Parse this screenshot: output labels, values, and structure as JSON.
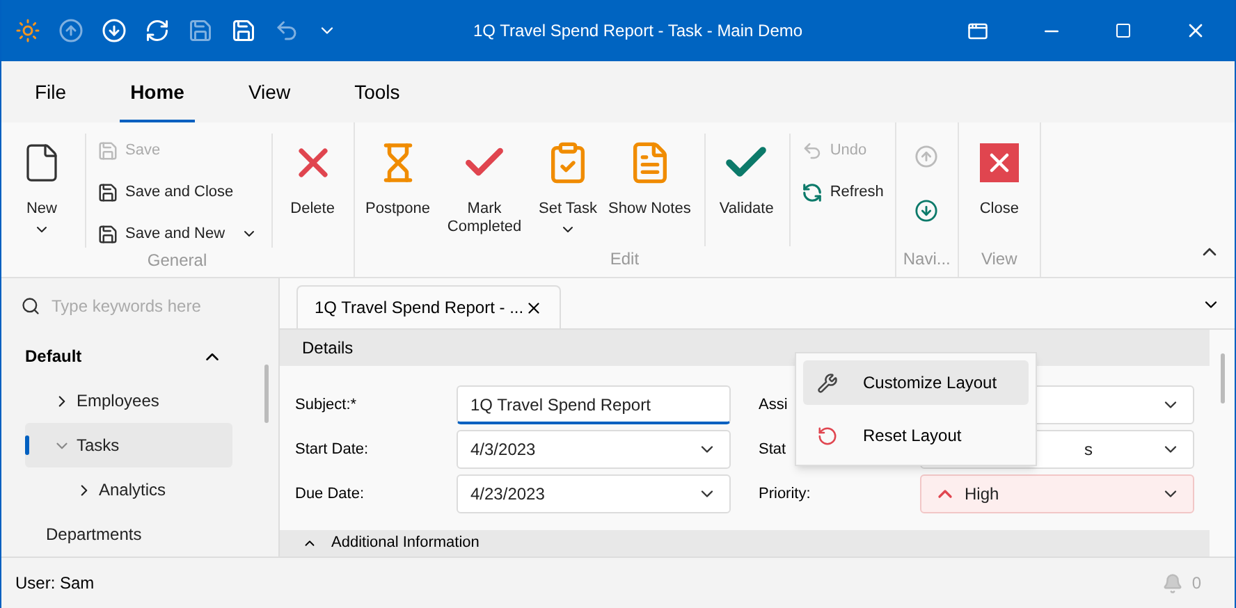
{
  "window": {
    "title": "1Q Travel Spend Report - Task - Main Demo"
  },
  "quick_access": [
    {
      "disabled": false
    },
    {
      "disabled": true
    },
    {
      "disabled": false
    },
    {
      "disabled": false
    },
    {
      "disabled": true
    },
    {
      "disabled": false
    },
    {
      "disabled": true
    },
    {
      "disabled": false
    }
  ],
  "menu_tabs": [
    {
      "label": "File",
      "selected": false
    },
    {
      "label": "Home",
      "selected": true
    },
    {
      "label": "View",
      "selected": false
    },
    {
      "label": "Tools",
      "selected": false
    }
  ],
  "ribbon": {
    "groups": [
      {
        "label": "General",
        "sections": [
          [
            {
              "kind": "large",
              "label": "New",
              "dropdown": true,
              "disabled": false
            }
          ],
          [
            {
              "kind": "stack",
              "items": [
                {
                  "label": "Save",
                  "disabled": true,
                  "dropdown": false
                },
                {
                  "label": "Save and Close",
                  "disabled": false,
                  "dropdown": false
                },
                {
                  "label": "Save and New",
                  "disabled": false,
                  "dropdown": true
                }
              ]
            }
          ],
          [
            {
              "kind": "large",
              "label": "Delete",
              "dropdown": false,
              "disabled": false
            }
          ]
        ]
      },
      {
        "label": "Edit",
        "sections": [
          [
            {
              "kind": "large",
              "label": "Postpone",
              "dropdown": false,
              "disabled": false
            },
            {
              "kind": "large",
              "label": "Mark Completed",
              "dropdown": false,
              "disabled": false
            },
            {
              "kind": "large",
              "label": "Set Task",
              "dropdown": true,
              "disabled": false
            },
            {
              "kind": "large",
              "label": "Show Notes",
              "dropdown": false,
              "disabled": false
            }
          ],
          [
            {
              "kind": "large",
              "label": "Validate",
              "dropdown": false,
              "disabled": false
            }
          ],
          [
            {
              "kind": "stack",
              "items": [
                {
                  "label": "Undo",
                  "disabled": true,
                  "dropdown": false
                },
                {
                  "label": "Refresh",
                  "disabled": false,
                  "dropdown": false
                }
              ]
            }
          ]
        ]
      },
      {
        "label": "Navi...",
        "sections": [
          [
            {
              "kind": "icons",
              "items": [
                {
                  "disabled": true
                },
                {
                  "disabled": false
                }
              ]
            }
          ]
        ]
      },
      {
        "label": "View",
        "sections": [
          [
            {
              "kind": "large",
              "label": "Close",
              "dropdown": false,
              "disabled": false
            }
          ]
        ]
      }
    ]
  },
  "navigation": {
    "search": {
      "placeholder": "Type keywords here"
    },
    "groups": [
      {
        "label": "Default",
        "expanded": true,
        "items": [
          {
            "label": "Employees",
            "expandable": true,
            "expanded": false,
            "selected": false
          },
          {
            "label": "Tasks",
            "expandable": true,
            "expanded": true,
            "selected": true,
            "children": [
              {
                "label": "Analytics",
                "expandable": true,
                "expanded": false,
                "selected": false
              }
            ]
          },
          {
            "label": "Departments",
            "expandable": false,
            "expanded": false,
            "selected": false
          }
        ]
      }
    ]
  },
  "document_tabs": [
    {
      "label": "1Q Travel Spend Report - ...",
      "selected": true
    }
  ],
  "form": {
    "section": "Details",
    "left": [
      {
        "label": "Subject:*",
        "kind": "text",
        "value": "1Q Travel Spend Report",
        "focused": true
      },
      {
        "label": "Start Date:",
        "kind": "date",
        "value": "4/3/2023",
        "focused": false
      },
      {
        "label": "Due Date:",
        "kind": "date",
        "value": "4/23/2023",
        "focused": false
      }
    ],
    "right": [
      {
        "label": "Assi",
        "kind": "combo",
        "focused": false
      },
      {
        "label": "Stat",
        "kind": "combo",
        "value": "s",
        "focused": false
      },
      {
        "label": "Priority:",
        "kind": "priority",
        "value": "High",
        "focused": false
      }
    ],
    "next_section": "Additional Information"
  },
  "context_menu": [
    {
      "label": "Customize Layout",
      "selected": true
    },
    {
      "label": "Reset Layout",
      "selected": false
    }
  ],
  "status_bar": {
    "user": "User: Sam",
    "notifications": "0"
  }
}
